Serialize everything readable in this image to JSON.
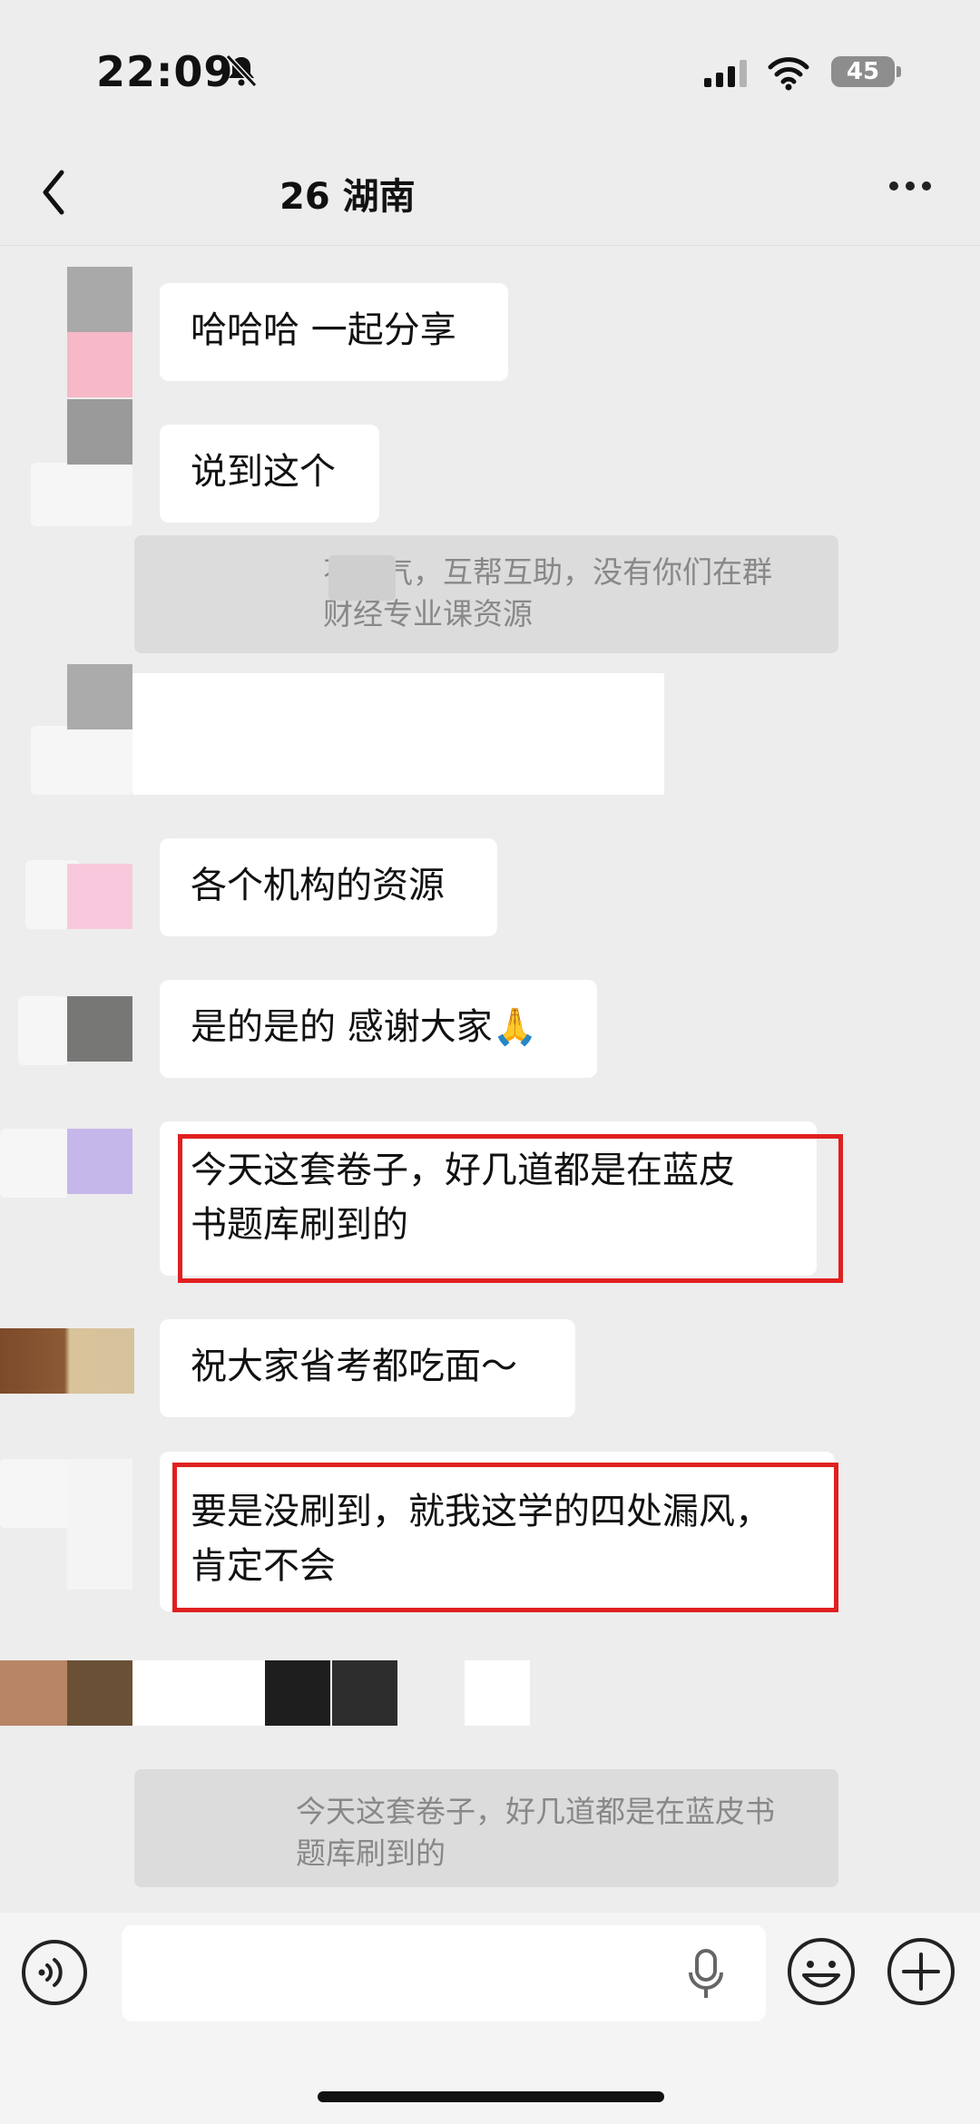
{
  "status_bar": {
    "time": "22:09",
    "battery": "45"
  },
  "nav": {
    "title": "26 湖南",
    "back_icon": "chevron-left-icon",
    "more_icon": "more-dots-icon"
  },
  "messages": [
    {
      "text": "哈哈哈 一起分享"
    },
    {
      "text": "说到这个"
    },
    {
      "quote": "不客气，互帮互助，没有你们在群\n财经专业课资源"
    },
    {
      "text": "各个机构的资源"
    },
    {
      "text": "是的是的 感谢大家🙏"
    },
    {
      "text": "今天这套卷子，好几道都是在蓝皮\n书题库刷到的",
      "highlighted": true
    },
    {
      "text": "祝大家省考都吃面～"
    },
    {
      "text": "要是没刷到，就我这学的四处漏风，\n肯定不会",
      "highlighted": true
    },
    {
      "quote": "今天这套卷子，好几道都是在蓝皮书\n题库刷到的"
    }
  ],
  "input_bar": {
    "placeholder": ""
  },
  "colors": {
    "background": "#ededed",
    "bubble": "#ffffff",
    "highlight_border": "#e02020"
  }
}
